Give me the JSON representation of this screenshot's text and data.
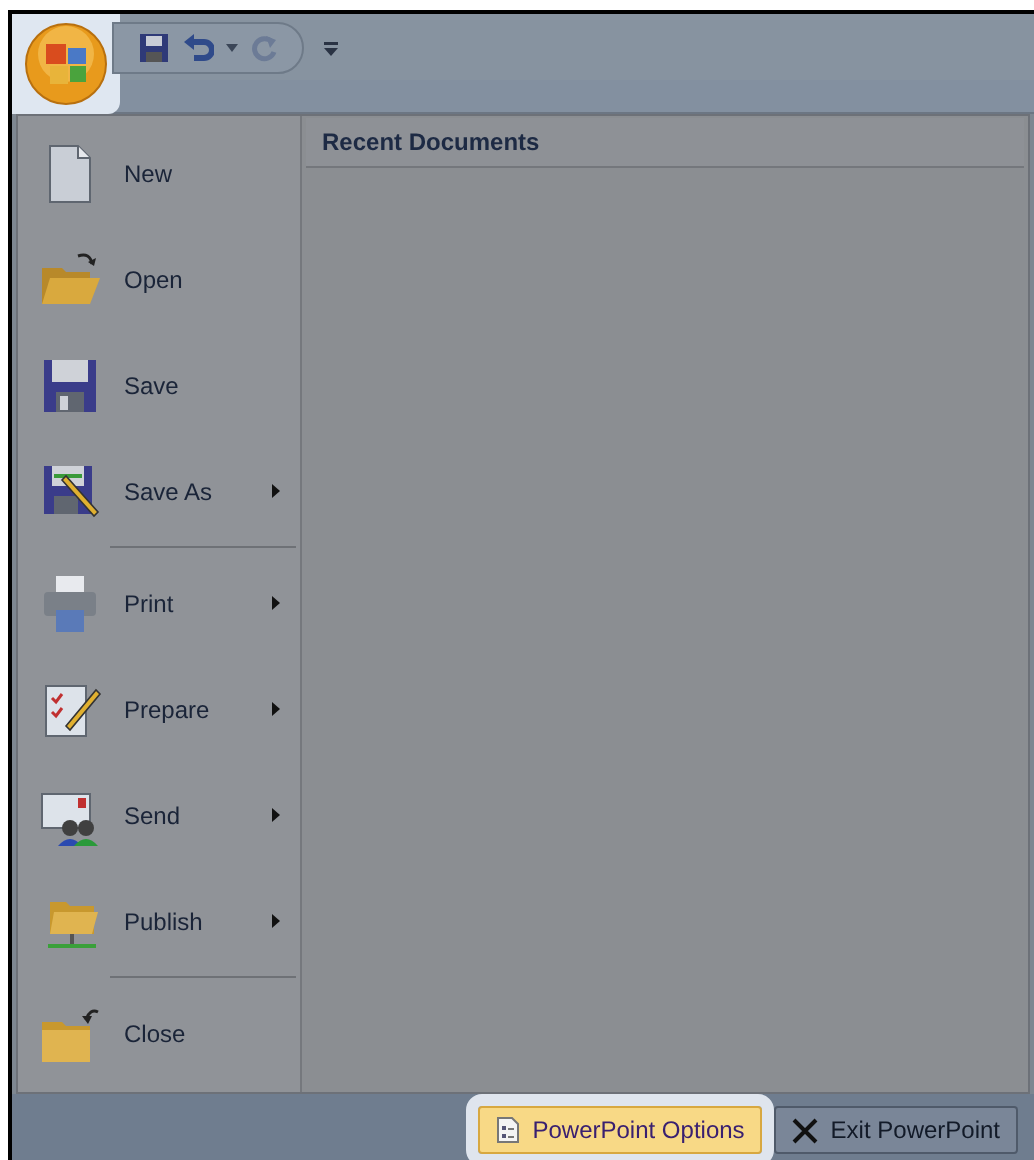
{
  "quick_access": {
    "office_button_highlighted": true
  },
  "menu": {
    "items": [
      {
        "label": "New",
        "has_submenu": false,
        "separator_before": false
      },
      {
        "label": "Open",
        "has_submenu": false,
        "separator_before": false
      },
      {
        "label": "Save",
        "has_submenu": false,
        "separator_before": false
      },
      {
        "label": "Save As",
        "has_submenu": true,
        "separator_before": false
      },
      {
        "label": "Print",
        "has_submenu": true,
        "separator_before": true
      },
      {
        "label": "Prepare",
        "has_submenu": true,
        "separator_before": false
      },
      {
        "label": "Send",
        "has_submenu": true,
        "separator_before": false
      },
      {
        "label": "Publish",
        "has_submenu": true,
        "separator_before": false
      },
      {
        "label": "Close",
        "has_submenu": false,
        "separator_before": true
      }
    ]
  },
  "recent_documents": {
    "title": "Recent Documents"
  },
  "footer_buttons": [
    {
      "label": "PowerPoint Options",
      "kind": "options",
      "selected": true
    },
    {
      "label": "Exit PowerPoint",
      "kind": "exit",
      "selected": false
    }
  ]
}
